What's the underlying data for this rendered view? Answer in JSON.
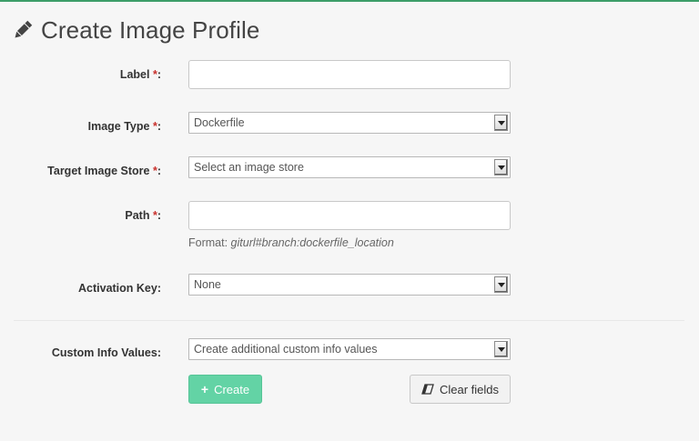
{
  "page": {
    "title": "Create Image Profile",
    "icon": "pencil-icon"
  },
  "fields": {
    "label": {
      "label": "Label",
      "required": "*",
      "colon": ":",
      "value": ""
    },
    "image_type": {
      "label": "Image Type",
      "required": "*",
      "colon": ":",
      "selected": "Dockerfile"
    },
    "target_store": {
      "label": "Target Image Store",
      "required": "*",
      "colon": ":",
      "selected": "Select an image store"
    },
    "path": {
      "label": "Path",
      "required": "*",
      "colon": ":",
      "value": "",
      "help_prefix": "Format: ",
      "help_example": "giturl#branch:dockerfile_location"
    },
    "activation_key": {
      "label": "Activation Key:",
      "selected": "None"
    },
    "custom_info": {
      "label": "Custom Info Values:",
      "selected": "Create additional custom info values"
    }
  },
  "buttons": {
    "create": "Create",
    "clear": "Clear fields"
  },
  "colors": {
    "accent": "#63d3a5",
    "required": "#c9302c",
    "top_line": "#3c9d68"
  }
}
